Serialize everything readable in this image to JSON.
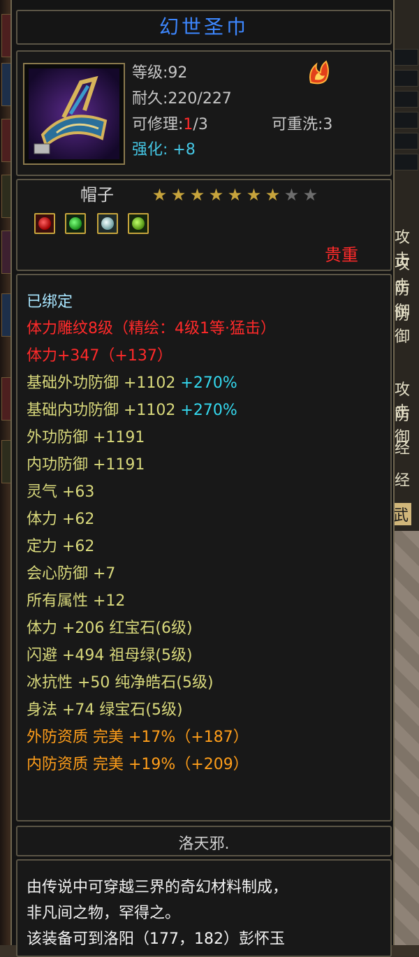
{
  "item": {
    "name": "幻世圣巾",
    "level": "等级:92",
    "durability": "耐久:220/227",
    "repair_prefix": "可修理:",
    "repair_current": "1",
    "repair_suffix": "/3",
    "rewash": "可重洗:3",
    "enhance_label": "强化:",
    "enhance_value": "+8",
    "type": "帽子",
    "stars_filled": 7,
    "stars_total": 9,
    "rarity": "贵重",
    "owner": "洛天邪."
  },
  "gems": [
    "red-gem-icon",
    "green-gem-icon",
    "white-gem-icon",
    "lime-gem-icon"
  ],
  "attributes": {
    "bound": "已绑定",
    "engrave": "体力雕纹8级（精绘：4级1等·猛击）",
    "stamina_engrave": "体力+347（+137）",
    "base_ext_def": "基础外功防御 +1102",
    "base_ext_def_pct": "+270%",
    "base_int_def": "基础内功防御 +1102",
    "base_int_def_pct": "+270%",
    "lines": [
      "外功防御 +1191",
      "内功防御 +1191",
      "灵气 +63",
      "体力 +62",
      "定力 +62",
      "会心防御 +7",
      "所有属性 +12"
    ],
    "gem_lines": [
      "体力 +206 红宝石(6级)",
      "闪避 +494 祖母绿(5级)",
      "冰抗性 +50 纯净皓石(5级)",
      "身法 +74 绿宝石(5级)"
    ],
    "quality_lines": [
      "外防资质  完美 +17%（+187）",
      "内防资质  完美 +19%（+209）"
    ]
  },
  "description": {
    "line1": "由传说中可穿越三界的奇幻材料制成，",
    "line2": "非凡间之物，罕得之。",
    "line3": "该装备可到洛阳（177，182）彭怀玉"
  },
  "side": {
    "labels": [
      "攻击",
      "攻击",
      "防御",
      "防御",
      "攻击",
      "防御",
      "经",
      "经",
      "武"
    ]
  },
  "colors": {
    "title": "#3d87ff",
    "red": "#ff2a2a",
    "yellow": "#d9d97c",
    "orange": "#ff9e1a",
    "cyan": "#34d8ee",
    "green": "#28d828"
  }
}
